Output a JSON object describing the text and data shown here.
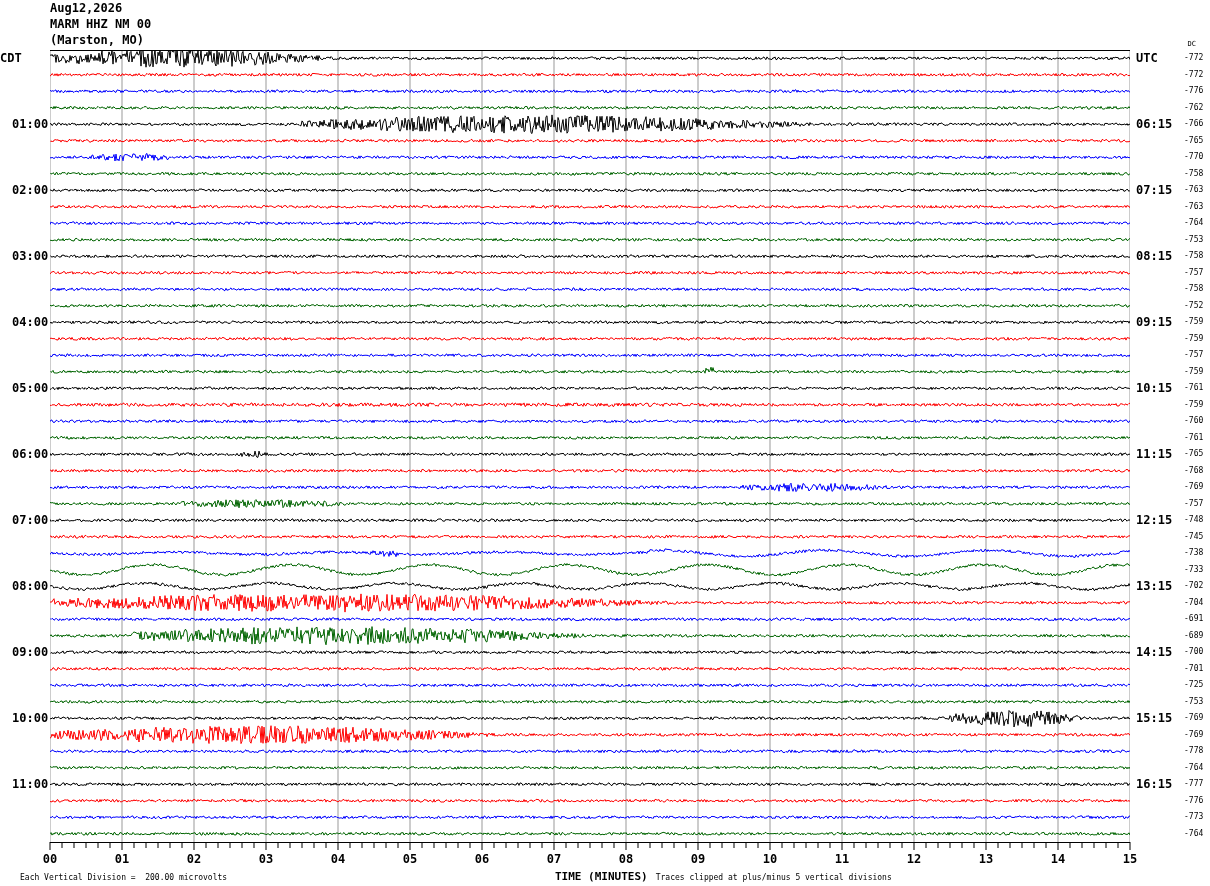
{
  "header": {
    "date": "Aug12,2026",
    "station": "MARM HHZ NM 00",
    "location": "(Marston, MO)"
  },
  "left_heading": "CDT",
  "right_heading": "UTC",
  "dc_heading": "DC",
  "hours": [
    {
      "local": "01:00",
      "utc": "06:15"
    },
    {
      "local": "02:00",
      "utc": "07:15"
    },
    {
      "local": "03:00",
      "utc": "08:15"
    },
    {
      "local": "04:00",
      "utc": "09:15"
    },
    {
      "local": "05:00",
      "utc": "10:15"
    },
    {
      "local": "06:00",
      "utc": "11:15"
    },
    {
      "local": "07:00",
      "utc": "12:15"
    },
    {
      "local": "08:00",
      "utc": "13:15"
    },
    {
      "local": "09:00",
      "utc": "14:15"
    },
    {
      "local": "10:00",
      "utc": "15:15"
    },
    {
      "local": "11:00",
      "utc": "16:15"
    }
  ],
  "traces": [
    {
      "color": "#000000",
      "dc": "-772"
    },
    {
      "color": "#ff0000",
      "dc": "-772"
    },
    {
      "color": "#0000ff",
      "dc": "-776"
    },
    {
      "color": "#006400",
      "dc": "-762"
    },
    {
      "color": "#000000",
      "dc": "-766"
    },
    {
      "color": "#ff0000",
      "dc": "-765"
    },
    {
      "color": "#0000ff",
      "dc": "-770"
    },
    {
      "color": "#006400",
      "dc": "-758"
    },
    {
      "color": "#000000",
      "dc": "-763"
    },
    {
      "color": "#ff0000",
      "dc": "-763"
    },
    {
      "color": "#0000ff",
      "dc": "-764"
    },
    {
      "color": "#006400",
      "dc": "-753"
    },
    {
      "color": "#000000",
      "dc": "-758"
    },
    {
      "color": "#ff0000",
      "dc": "-757"
    },
    {
      "color": "#0000ff",
      "dc": "-758"
    },
    {
      "color": "#006400",
      "dc": "-752"
    },
    {
      "color": "#000000",
      "dc": "-759"
    },
    {
      "color": "#ff0000",
      "dc": "-759"
    },
    {
      "color": "#0000ff",
      "dc": "-757"
    },
    {
      "color": "#006400",
      "dc": "-759"
    },
    {
      "color": "#000000",
      "dc": "-761"
    },
    {
      "color": "#ff0000",
      "dc": "-759"
    },
    {
      "color": "#0000ff",
      "dc": "-760"
    },
    {
      "color": "#006400",
      "dc": "-761"
    },
    {
      "color": "#000000",
      "dc": "-765"
    },
    {
      "color": "#ff0000",
      "dc": "-768"
    },
    {
      "color": "#0000ff",
      "dc": "-769"
    },
    {
      "color": "#006400",
      "dc": "-757"
    },
    {
      "color": "#000000",
      "dc": "-748"
    },
    {
      "color": "#ff0000",
      "dc": "-745"
    },
    {
      "color": "#0000ff",
      "dc": "-738"
    },
    {
      "color": "#006400",
      "dc": "-733"
    },
    {
      "color": "#000000",
      "dc": "-702"
    },
    {
      "color": "#ff0000",
      "dc": "-704"
    },
    {
      "color": "#0000ff",
      "dc": "-691"
    },
    {
      "color": "#006400",
      "dc": "-689"
    },
    {
      "color": "#000000",
      "dc": "-700"
    },
    {
      "color": "#ff0000",
      "dc": "-701"
    },
    {
      "color": "#0000ff",
      "dc": "-725"
    },
    {
      "color": "#006400",
      "dc": "-753"
    },
    {
      "color": "#000000",
      "dc": "-769"
    },
    {
      "color": "#ff0000",
      "dc": "-769"
    },
    {
      "color": "#0000ff",
      "dc": "-778"
    },
    {
      "color": "#006400",
      "dc": "-764"
    },
    {
      "color": "#000000",
      "dc": "-777"
    },
    {
      "color": "#ff0000",
      "dc": "-776"
    },
    {
      "color": "#0000ff",
      "dc": "-773"
    },
    {
      "color": "#006400",
      "dc": "-764"
    }
  ],
  "x_ticks": [
    "00",
    "01",
    "02",
    "03",
    "04",
    "05",
    "06",
    "07",
    "08",
    "09",
    "10",
    "11",
    "12",
    "13",
    "14",
    "15"
  ],
  "x_label": "TIME (MINUTES)",
  "scale_note": "Each Vertical Division =  200.00 microvolts",
  "clip_note": "Traces clipped at plus/minus 5 vertical divisions"
}
